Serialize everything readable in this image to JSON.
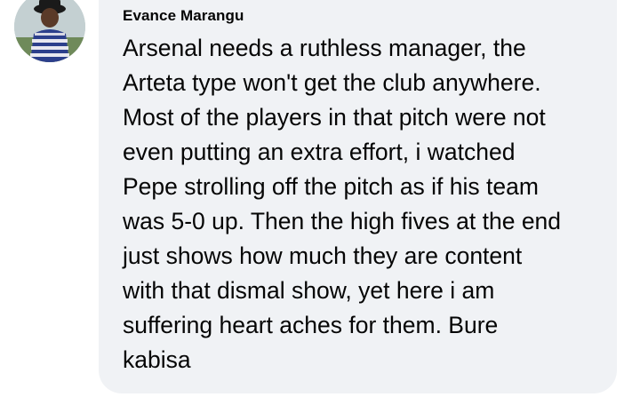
{
  "comment": {
    "author": "Evance Marangu",
    "text": "Arsenal needs a ruthless manager, the\nArteta type won't get the club anywhere.\nMost of the players in that pitch were not\neven putting an extra effort, i watched\nPepe strolling off the pitch as if his team\nwas 5-0 up. Then the high fives at the end\njust shows how much they are content\nwith that dismal show, yet here i am\nsuffering heart aches for them. Bure\nkabisa"
  },
  "colors": {
    "bubble_background": "#f0f2f5",
    "text": "#050505"
  }
}
